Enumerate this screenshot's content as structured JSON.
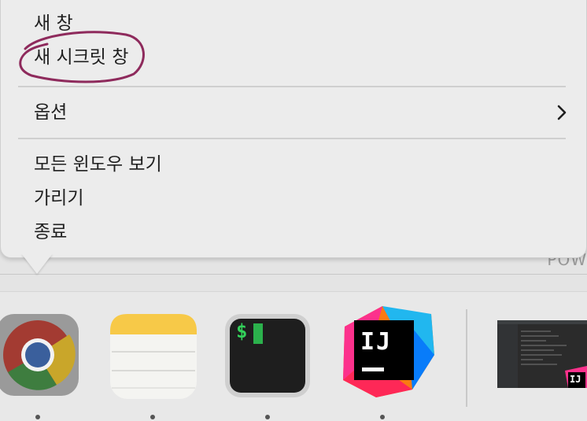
{
  "menu": {
    "items": [
      {
        "label": "새 창"
      },
      {
        "label": "새 시크릿 창"
      },
      {
        "label": "옵션"
      },
      {
        "label": "모든 윈도우 보기"
      },
      {
        "label": "가리기"
      },
      {
        "label": "종료"
      }
    ]
  },
  "background": {
    "partial_text": "POW"
  },
  "dock": {
    "apps": [
      {
        "name": "Chrome",
        "icon": "chrome-icon"
      },
      {
        "name": "Notes",
        "icon": "notes-icon"
      },
      {
        "name": "Terminal",
        "icon": "terminal-icon",
        "prompt": "$"
      },
      {
        "name": "IntelliJ IDEA",
        "icon": "intellij-icon",
        "logo_text": "IJ"
      },
      {
        "name": "Minimized window",
        "icon": "window-thumbnail-icon",
        "badge_text": "IJ"
      }
    ]
  },
  "colors": {
    "annotation_circle": "#8e2a5c",
    "menu_bg": "#ececec",
    "dock_bg": "#e8e8e8"
  }
}
